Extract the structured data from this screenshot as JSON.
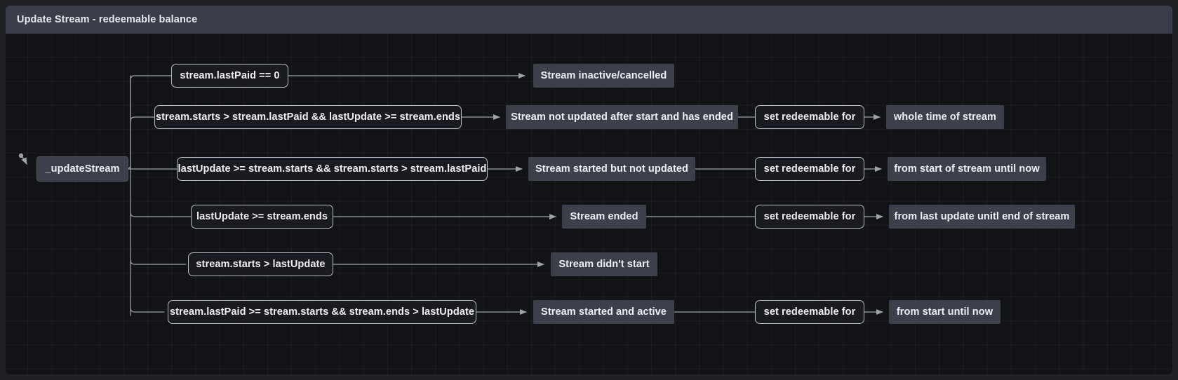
{
  "window": {
    "title": "Update Stream - redeemable balance"
  },
  "diagram": {
    "root": {
      "label": "_updateStream"
    },
    "branches": [
      {
        "condition": "stream.lastPaid == 0",
        "result": "Stream inactive/cancelled",
        "action": null,
        "outcome": null
      },
      {
        "condition": "stream.starts > stream.lastPaid && lastUpdate >= stream.ends",
        "result": "Stream not updated after start and has ended",
        "action": "set redeemable for",
        "outcome": "whole time of stream"
      },
      {
        "condition": "lastUpdate >= stream.starts && stream.starts > stream.lastPaid",
        "result": "Stream started but not updated",
        "action": "set redeemable for",
        "outcome": "from start of stream until now"
      },
      {
        "condition": "lastUpdate >= stream.ends",
        "result": "Stream ended",
        "action": "set redeemable for",
        "outcome": "from last update unitl end of stream"
      },
      {
        "condition": "stream.starts > lastUpdate",
        "result": "Stream didn't start",
        "action": null,
        "outcome": null
      },
      {
        "condition": "stream.lastPaid >= stream.starts && stream.ends > lastUpdate",
        "result": "Stream started and active",
        "action": "set redeemable for",
        "outcome": "from start until now"
      }
    ],
    "colors": {
      "canvas_background": "#121316",
      "titlebar_background": "#3b3d49",
      "result_node_fill": "#3d3f4b",
      "condition_node_fill": "#1a1b20",
      "condition_node_border": "#b9bcc6",
      "edge_stroke": "#9fa2ac",
      "text": "#eceef2"
    }
  }
}
